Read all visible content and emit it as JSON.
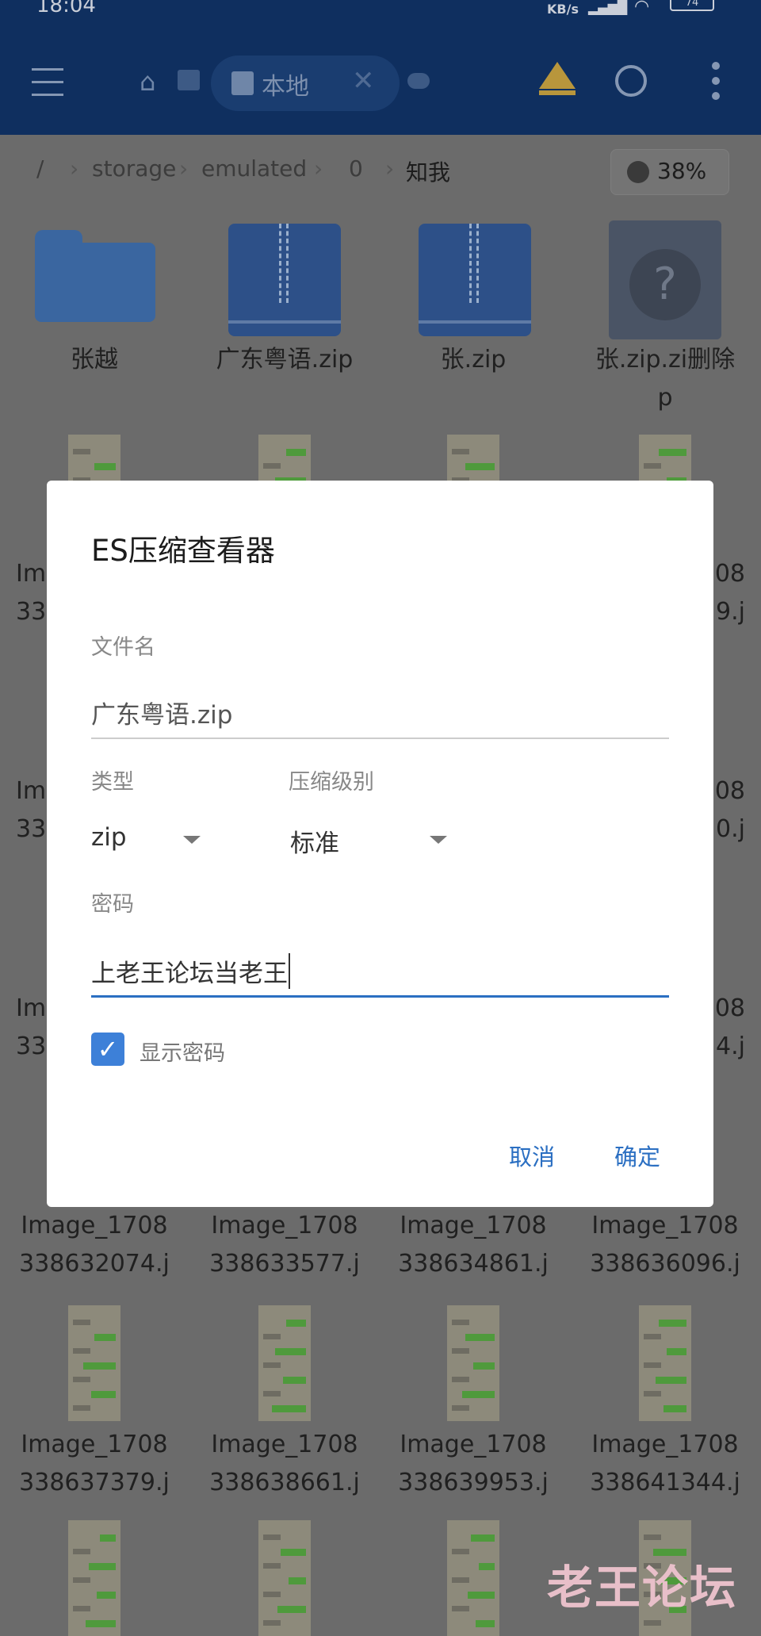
{
  "status_bar": {
    "time": "18:04",
    "speed_unit": "KB/s",
    "battery": "74"
  },
  "header": {
    "tab_label": "本地",
    "colors": {
      "header_bg": "#0f2f5f",
      "accent": "#2b6fc2",
      "crown": "#c9a544"
    }
  },
  "breadcrumb": {
    "items": [
      "/",
      "storage",
      "emulated",
      "0",
      "知我"
    ],
    "storage_usage": "38%"
  },
  "files": {
    "top_row": [
      {
        "name": "张越",
        "type": "folder"
      },
      {
        "name": "广东粤语.zip",
        "type": "zip"
      },
      {
        "name": "张.zip",
        "type": "zip"
      },
      {
        "name": "张.zip.zi删除",
        "name_line2": "p",
        "type": "unknown"
      }
    ],
    "image_rows": [
      [
        [
          "Ima",
          "33"
        ],
        null,
        null,
        [
          "708",
          "9.j"
        ]
      ],
      [
        [
          "Ima",
          "33"
        ],
        null,
        null,
        [
          "708",
          "0.j"
        ]
      ],
      [
        [
          "Im",
          "33"
        ],
        null,
        null,
        [
          "708",
          "4.j"
        ]
      ],
      [
        [
          "Image_1708",
          "338632074.j"
        ],
        [
          "Image_1708",
          "338633577.j"
        ],
        [
          "Image_1708",
          "338634861.j"
        ],
        [
          "Image_1708",
          "338636096.j"
        ]
      ],
      [
        [
          "Image_1708",
          "338637379.j"
        ],
        [
          "Image_1708",
          "338638661.j"
        ],
        [
          "Image_1708",
          "338639953.j"
        ],
        [
          "Image_1708",
          "338641344.j"
        ]
      ],
      [
        null,
        null,
        null,
        null
      ]
    ]
  },
  "dialog": {
    "title": "ES压缩查看器",
    "filename_label": "文件名",
    "filename_value": "广东粤语.zip",
    "type_label": "类型",
    "type_value": "zip",
    "level_label": "压缩级别",
    "level_value": "标准",
    "password_label": "密码",
    "password_value": "上老王论坛当老王",
    "show_password_label": "显示密码",
    "show_password_checked": true,
    "cancel": "取消",
    "ok": "确定"
  },
  "watermark": "老王论坛"
}
